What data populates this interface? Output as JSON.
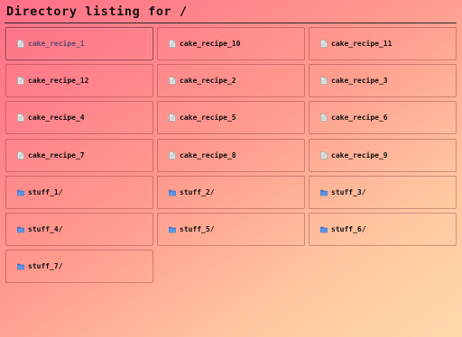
{
  "page": {
    "title": "Directory listing for /"
  },
  "entries": [
    {
      "name": "cake_recipe_1",
      "icon": "file-icon",
      "active": true
    },
    {
      "name": "cake_recipe_10",
      "icon": "file-icon"
    },
    {
      "name": "cake_recipe_11",
      "icon": "file-icon"
    },
    {
      "name": "cake_recipe_12",
      "icon": "file-icon"
    },
    {
      "name": "cake_recipe_2",
      "icon": "file-icon"
    },
    {
      "name": "cake_recipe_3",
      "icon": "file-icon"
    },
    {
      "name": "cake_recipe_4",
      "icon": "file-icon"
    },
    {
      "name": "cake_recipe_5",
      "icon": "file-icon"
    },
    {
      "name": "cake_recipe_6",
      "icon": "file-icon"
    },
    {
      "name": "cake_recipe_7",
      "icon": "file-icon"
    },
    {
      "name": "cake_recipe_8",
      "icon": "file-icon"
    },
    {
      "name": "cake_recipe_9",
      "icon": "file-icon"
    },
    {
      "name": "stuff_1/",
      "icon": "folder-icon"
    },
    {
      "name": "stuff_2/",
      "icon": "folder-icon"
    },
    {
      "name": "stuff_3/",
      "icon": "folder-icon"
    },
    {
      "name": "stuff_4/",
      "icon": "folder-icon"
    },
    {
      "name": "stuff_5/",
      "icon": "folder-icon"
    },
    {
      "name": "stuff_6/",
      "icon": "folder-icon"
    },
    {
      "name": "stuff_7/",
      "icon": "folder-icon"
    }
  ],
  "colors": {
    "background_start": "#ff6e88",
    "background_end": "#ffd9ab",
    "folder_icon": "#3f7fd6",
    "file_icon": "#e4e4e4"
  }
}
